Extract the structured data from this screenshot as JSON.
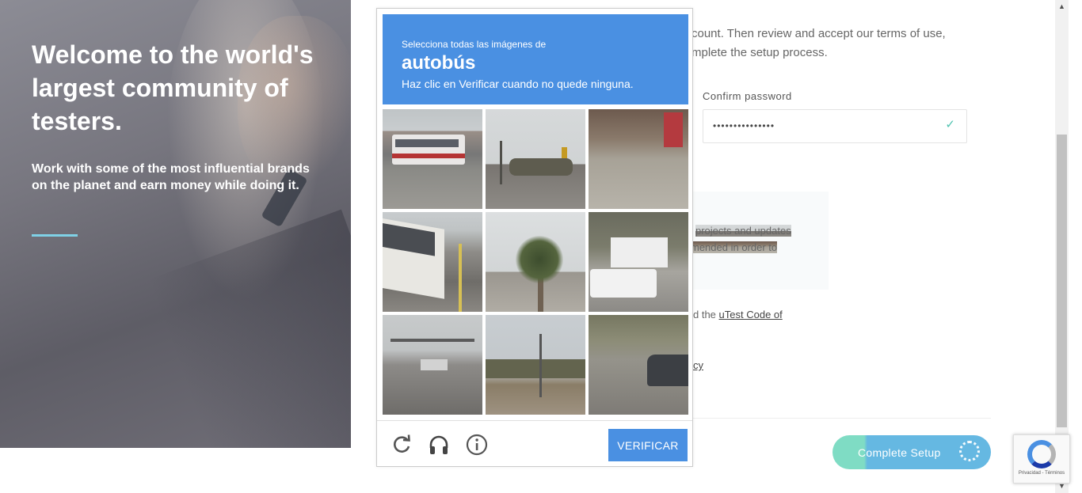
{
  "hero": {
    "title": "Welcome to the world's largest community of testers.",
    "subtitle": "Work with some of the most influential brands on the planet and earn money while doing it."
  },
  "form": {
    "intro_line1": "count. Then review and accept our terms of use,",
    "intro_line2": "mplete the setup process.",
    "confirm_password_label": "Confirm password",
    "confirm_password_value": "•••••••••••••••",
    "info_line1": "projects and updates",
    "info_line2": "mended in order to",
    "code_prefix": "d the ",
    "code_link": "uTest Code of",
    "privacy_fragment": "cy",
    "complete_button": "Complete Setup"
  },
  "captcha": {
    "instruction": "Selecciona todas las imágenes de",
    "target": "autobús",
    "hint": "Haz clic en Verificar cuando no quede ninguna.",
    "verify_button": "VERIFICAR",
    "icons": [
      "reload-icon",
      "headphones-icon",
      "info-icon"
    ],
    "tiles": [
      "tile-1",
      "tile-2",
      "tile-3",
      "tile-4",
      "tile-5",
      "tile-6",
      "tile-7",
      "tile-8",
      "tile-9"
    ]
  },
  "recaptcha_badge": {
    "text": "Privacidad - Términos"
  },
  "colors": {
    "captcha_blue": "#4a90e2",
    "hero_accent": "#7fd1e6",
    "button_teal": "#7fdcc4",
    "button_blue": "#65b8e2"
  }
}
